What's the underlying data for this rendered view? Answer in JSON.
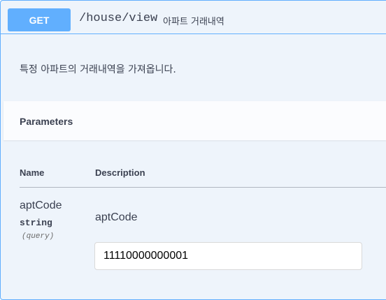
{
  "colors": {
    "get_accent": "#61affe",
    "block_background": "#eef4fb",
    "text": "#3b4151"
  },
  "operation": {
    "method": "GET",
    "path": "/house/view",
    "summary": "아파트 거래내역",
    "description": "특정 아파트의 거래내역을 가져옵니다."
  },
  "parameters_section": {
    "title": "Parameters",
    "columns": {
      "name": "Name",
      "description": "Description"
    },
    "params": [
      {
        "name": "aptCode",
        "type": "string",
        "in": "(query)",
        "description": "aptCode",
        "value": "11110000000001"
      }
    ]
  }
}
